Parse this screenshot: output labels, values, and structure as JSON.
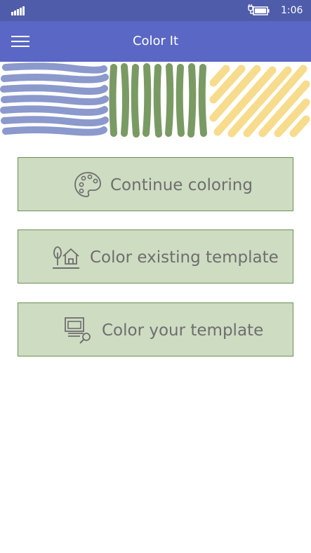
{
  "status_bar": {
    "time": "1:06",
    "signal_icon": "signal-bars-icon",
    "battery_icon": "battery-charging-icon"
  },
  "header": {
    "title": "Color It",
    "menu_icon": "hamburger-menu-icon"
  },
  "colors": {
    "status_bar": "#4f5caa",
    "header": "#5a67c4",
    "blue_stroke": "#8b99cc",
    "green_stroke": "#7a9a63",
    "yellow_stroke": "#f6dc8c",
    "button_fill": "#cedcc2",
    "button_border": "#6a8f55",
    "button_text": "#6e6e6e"
  },
  "menu": {
    "continue": {
      "label": "Continue coloring",
      "icon": "palette-icon"
    },
    "existing": {
      "label": "Color existing template",
      "icon": "tree-house-icon"
    },
    "yours": {
      "label": "Color your template",
      "icon": "pictures-search-icon"
    }
  }
}
